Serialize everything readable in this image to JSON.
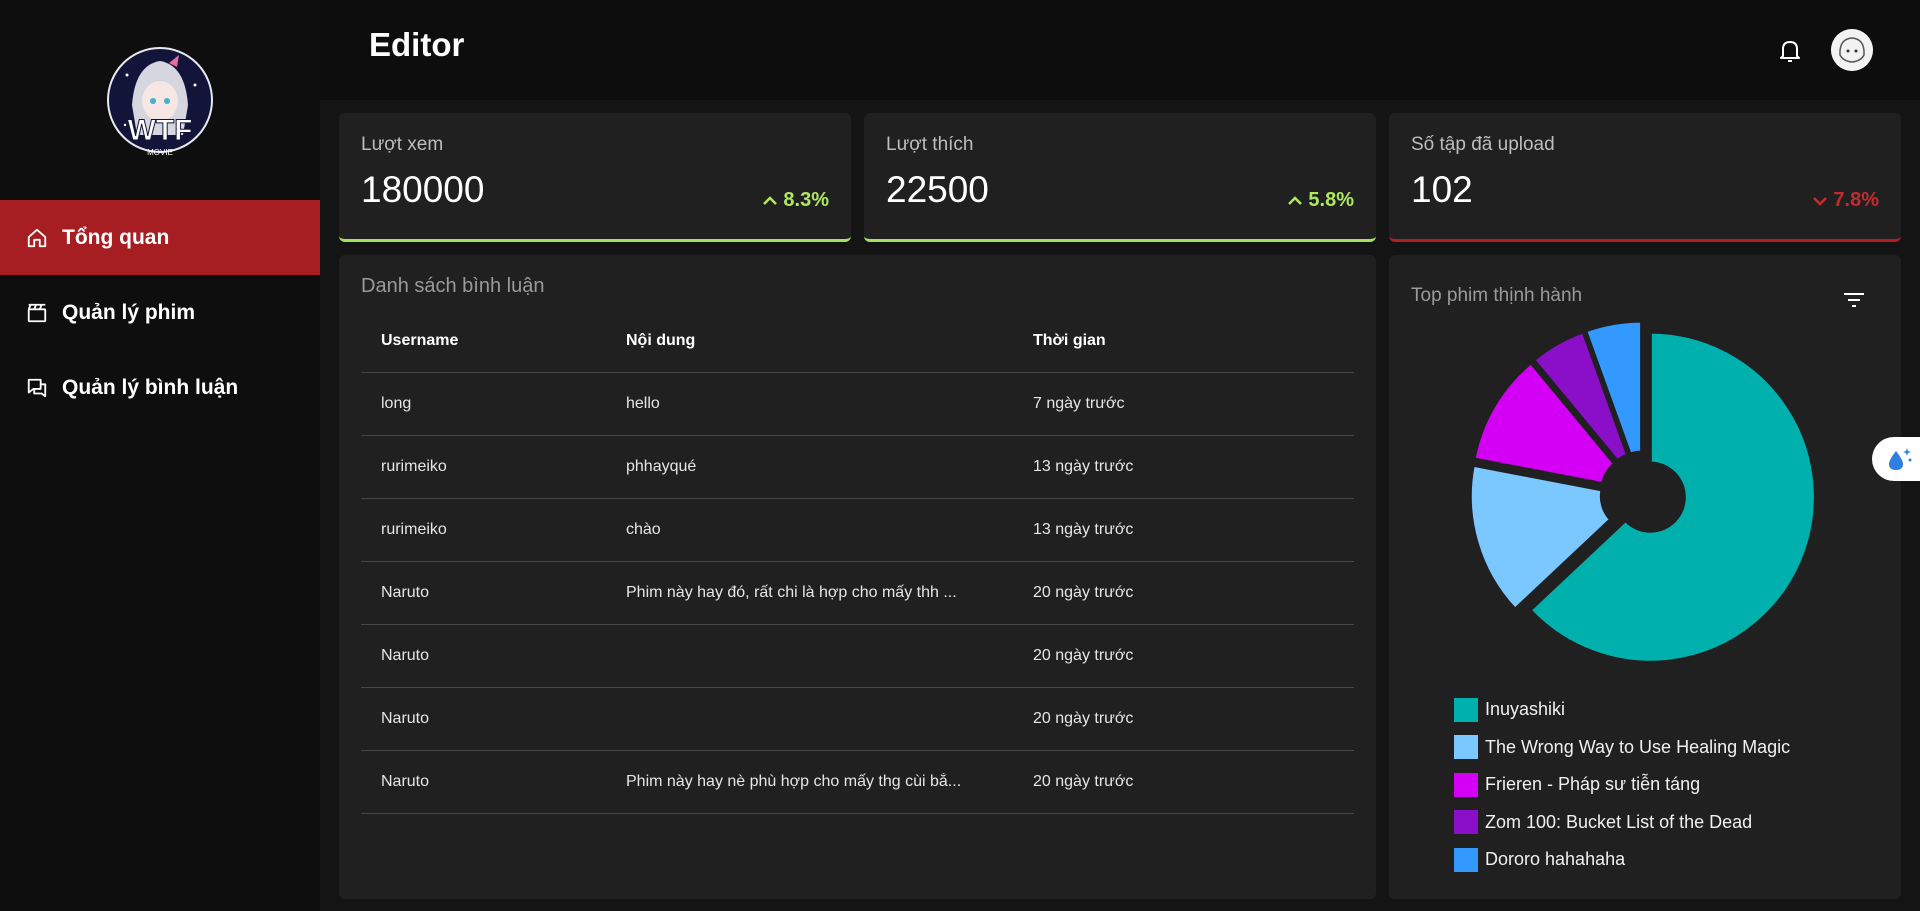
{
  "header": {
    "title": "Editor"
  },
  "logo": {
    "text": "WTF",
    "subtext": "MOVIE"
  },
  "sidebar": {
    "items": [
      {
        "label": "Tổng quan",
        "icon": "home-icon",
        "active": true
      },
      {
        "label": "Quản lý phim",
        "icon": "clapperboard-icon",
        "active": false
      },
      {
        "label": "Quản lý bình luận",
        "icon": "chat-icon",
        "active": false
      }
    ]
  },
  "stats": [
    {
      "label": "Lượt xem",
      "value": "180000",
      "delta": "8.3%",
      "trend": "up"
    },
    {
      "label": "Lượt thích",
      "value": "22500",
      "delta": "5.8%",
      "trend": "up"
    },
    {
      "label": "Số tập đã upload",
      "value": "102",
      "delta": "7.8%",
      "trend": "down"
    }
  ],
  "colors": {
    "up": "#aee85e",
    "down": "#c62a2f",
    "active_nav": "#a61e22"
  },
  "comments": {
    "title": "Danh sách bình luận",
    "headers": [
      "Username",
      "Nội dung",
      "Thời gian"
    ],
    "rows": [
      {
        "user": "long",
        "content": "hello",
        "time": "7 ngày trước"
      },
      {
        "user": "rurimeiko",
        "content": "phhayqué",
        "time": "13 ngày trước"
      },
      {
        "user": "rurimeiko",
        "content": "chào",
        "time": "13 ngày trước"
      },
      {
        "user": "Naruto",
        "content": "Phim này hay đó, rất chi là hợp cho mấy thh ...",
        "time": "20 ngày trước"
      },
      {
        "user": "Naruto",
        "content": "",
        "time": "20 ngày trước"
      },
      {
        "user": "Naruto",
        "content": "",
        "time": "20 ngày trước"
      },
      {
        "user": "Naruto",
        "content": "Phim này hay nè phù hợp cho mấy thg cùi bắ...",
        "time": "20 ngày trước"
      }
    ]
  },
  "chart_data": {
    "type": "pie",
    "title": "Top phim thịnh hành",
    "legend_position": "bottom",
    "series": [
      {
        "name": "Inuyashiki",
        "value": 63,
        "color": "#00b0ad"
      },
      {
        "name": "The Wrong Way to Use Healing Magic",
        "value": 15,
        "color": "#7ac8ff"
      },
      {
        "name": "Frieren - Pháp sư tiễn táng",
        "value": 11,
        "color": "#d400f5"
      },
      {
        "name": "Zom 100: Bucket List of the Dead",
        "value": 5.5,
        "color": "#8b0fc9"
      },
      {
        "name": "Dororo hahahaha",
        "value": 5.5,
        "color": "#3399ff"
      }
    ]
  }
}
